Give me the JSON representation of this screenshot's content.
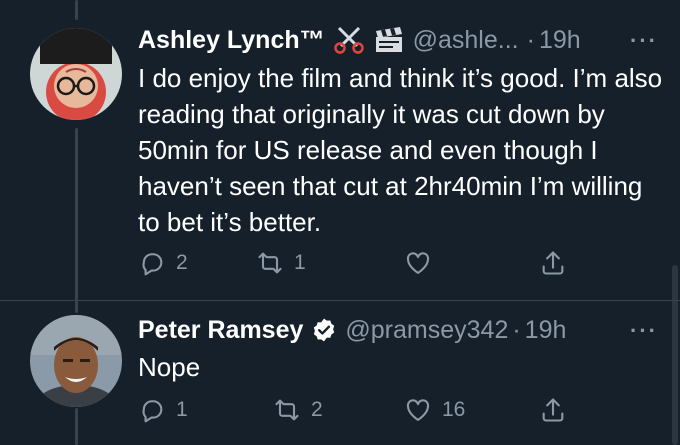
{
  "tweets": [
    {
      "name": "Ashley Lynch™",
      "emojis": [
        "scissors-emoji",
        "clapper-board-emoji"
      ],
      "handle": "@ashle...",
      "dot": "·",
      "time": "19h",
      "more": "···",
      "text": "I do enjoy the film and think it’s good. I’m also reading that originally it was cut down by 50min for US release and even though I haven’t seen that cut at 2hr40min I’m willing to bet it’s better.",
      "replies": "2",
      "retweets": "1",
      "likes": "",
      "verified": false
    },
    {
      "name": "Peter Ramsey",
      "handle": "@pramsey342",
      "dot": "·",
      "time": "19h",
      "more": "···",
      "text": "Nope",
      "replies": "1",
      "retweets": "2",
      "likes": "16",
      "verified": true
    }
  ],
  "colors": {
    "background": "#15202b",
    "secondary_text": "#8b98a5",
    "verified": "#ffffff",
    "divider": "#38444d"
  }
}
